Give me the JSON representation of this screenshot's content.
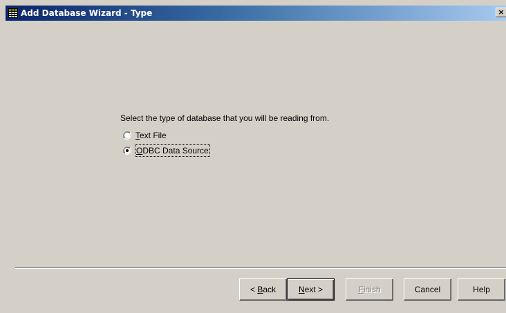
{
  "window": {
    "title": "Add Database Wizard - Type",
    "close_label": "×",
    "icon": "grid-table-icon"
  },
  "main": {
    "prompt": "Select the type of database that you will be reading from.",
    "options": [
      {
        "mnemonic": "T",
        "rest": "ext File",
        "selected": false
      },
      {
        "mnemonic": "O",
        "rest": "DBC Data Source",
        "selected": true
      }
    ]
  },
  "buttons": {
    "back": {
      "prefix": "< ",
      "mnemonic": "B",
      "rest": "ack"
    },
    "next": {
      "mnemonic": "N",
      "rest": "ext >"
    },
    "finish": {
      "mnemonic": "F",
      "rest": "inish",
      "disabled": true
    },
    "cancel": "Cancel",
    "help": "Help"
  },
  "colors": {
    "face": "#d4d0c8",
    "title_start": "#0a246a",
    "title_end": "#a6caf0"
  }
}
